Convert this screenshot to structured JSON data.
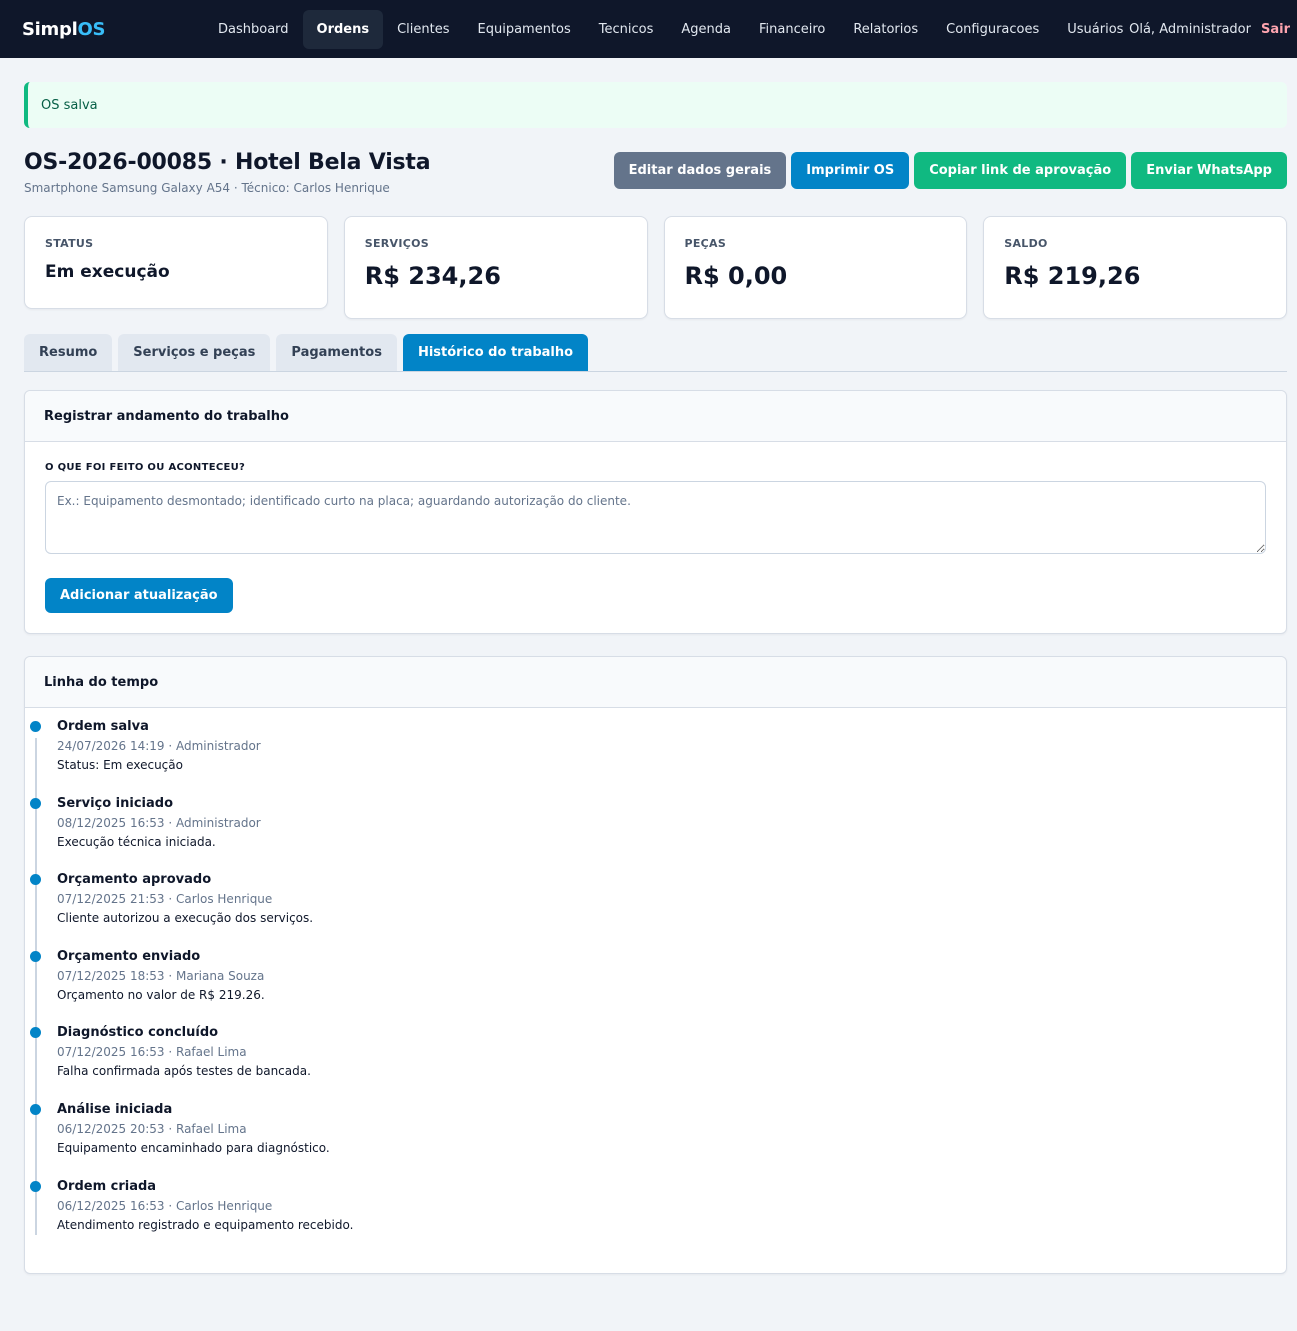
{
  "nav": {
    "brand_main": "Simpl",
    "brand_accent": "OS",
    "items": [
      {
        "label": "Dashboard"
      },
      {
        "label": "Ordens"
      },
      {
        "label": "Clientes"
      },
      {
        "label": "Equipamentos"
      },
      {
        "label": "Tecnicos"
      },
      {
        "label": "Agenda"
      },
      {
        "label": "Financeiro"
      },
      {
        "label": "Relatorios"
      },
      {
        "label": "Configuracoes"
      },
      {
        "label": "Usuários"
      }
    ],
    "active_item": "Ordens",
    "greeting": "Olá, Administrador",
    "logout": "Sair"
  },
  "alert": {
    "message": "OS salva"
  },
  "header": {
    "title": "OS-2026-00085 · Hotel Bela Vista",
    "subtitle": "Smartphone Samsung Galaxy A54 · Técnico: Carlos Henrique",
    "actions": {
      "edit": "Editar dados gerais",
      "print": "Imprimir OS",
      "copy_link": "Copiar link de aprovação",
      "whatsapp": "Enviar WhatsApp"
    }
  },
  "summary": {
    "status": {
      "label": "STATUS",
      "value": "Em execução"
    },
    "services": {
      "label": "SERVIÇOS",
      "value": "R$ 234,26"
    },
    "parts": {
      "label": "PEÇAS",
      "value": "R$ 0,00"
    },
    "balance": {
      "label": "SALDO",
      "value": "R$ 219,26"
    }
  },
  "tabs": [
    {
      "label": "Resumo"
    },
    {
      "label": "Serviços e peças"
    },
    {
      "label": "Pagamentos"
    },
    {
      "label": "Histórico do trabalho"
    }
  ],
  "active_tab": "Histórico do trabalho",
  "register": {
    "title": "Registrar andamento do trabalho",
    "field_label": "O QUE FOI FEITO OU ACONTECEU?",
    "placeholder": "Ex.: Equipamento desmontado; identificado curto na placa; aguardando autorização do cliente.",
    "value": "",
    "submit": "Adicionar atualização"
  },
  "timeline": {
    "title": "Linha do tempo",
    "events": [
      {
        "title": "Ordem salva",
        "meta": "24/07/2026 14:19 · Administrador",
        "desc": "Status: Em execução"
      },
      {
        "title": "Serviço iniciado",
        "meta": "08/12/2025 16:53 · Administrador",
        "desc": "Execução técnica iniciada."
      },
      {
        "title": "Orçamento aprovado",
        "meta": "07/12/2025 21:53 · Carlos Henrique",
        "desc": "Cliente autorizou a execução dos serviços."
      },
      {
        "title": "Orçamento enviado",
        "meta": "07/12/2025 18:53 · Mariana Souza",
        "desc": "Orçamento no valor de R$ 219.26."
      },
      {
        "title": "Diagnóstico concluído",
        "meta": "07/12/2025 16:53 · Rafael Lima",
        "desc": "Falha confirmada após testes de bancada."
      },
      {
        "title": "Análise iniciada",
        "meta": "06/12/2025 20:53 · Rafael Lima",
        "desc": "Equipamento encaminhado para diagnóstico."
      },
      {
        "title": "Ordem criada",
        "meta": "06/12/2025 16:53 · Carlos Henrique",
        "desc": "Atendimento registrado e equipamento recebido."
      }
    ]
  },
  "colors": {
    "nav_bg": "#0f172a",
    "primary": "#0284c7",
    "success": "#10b981",
    "secondary": "#64748b",
    "alert_bg": "#ecfdf5"
  }
}
